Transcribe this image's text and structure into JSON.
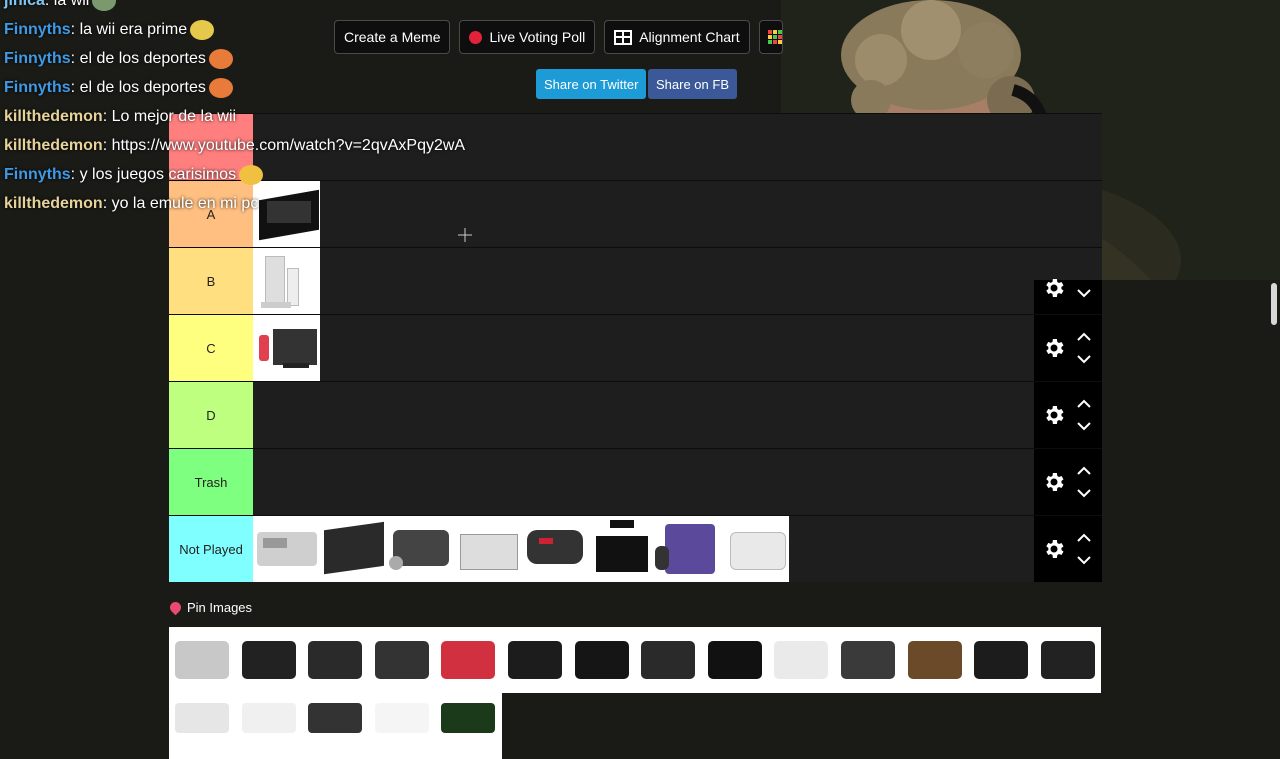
{
  "toolbar": {
    "create_meme": "Create a Meme",
    "live_poll": "Live Voting Poll",
    "alignment": "Alignment Chart",
    "share_twitter": "Share on Twitter",
    "share_fb": "Share on FB"
  },
  "tiers": [
    {
      "label": "A",
      "color": "#ffbf80"
    },
    {
      "label": "B",
      "color": "#ffdf80"
    },
    {
      "label": "C",
      "color": "#ffff7f"
    },
    {
      "label": "D",
      "color": "#bfff7f"
    },
    {
      "label": "Trash",
      "color": "#7fff7f"
    },
    {
      "label": "Not Played",
      "color": "#7fffff"
    }
  ],
  "top_tier_color": "#ff7f7f",
  "pin_label": "Pin Images",
  "chat": [
    {
      "user": "jinica",
      "text": ": la wii",
      "cls": "nick-c"
    },
    {
      "user": "Finnyths",
      "text": ": la wii era prime",
      "cls": "nick-a"
    },
    {
      "user": "Finnyths",
      "text": ": el de los deportes",
      "cls": "nick-a"
    },
    {
      "user": "Finnyths",
      "text": ": el de los deportes",
      "cls": "nick-a"
    },
    {
      "user": "killthedemon",
      "text": ": Lo mejor de la wii",
      "cls": "nick-b"
    },
    {
      "user": "killthedemon",
      "text": ": https://www.youtube.com/watch?v=2qvAxPqy2wA",
      "cls": "nick-b"
    },
    {
      "user": "Finnyths",
      "text": ": y los juegos carisimos",
      "cls": "nick-a"
    },
    {
      "user": "killthedemon",
      "text": ": yo la emule en mi pc",
      "cls": "nick-b"
    }
  ]
}
